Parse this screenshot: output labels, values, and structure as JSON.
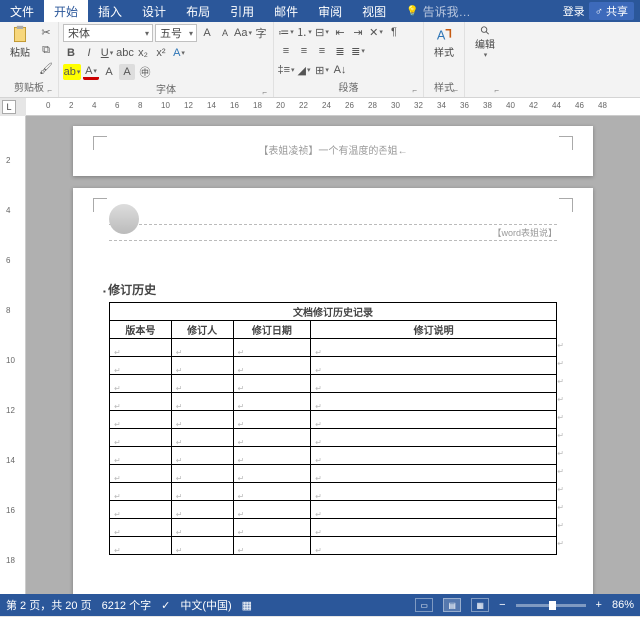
{
  "tabs": {
    "file": "文件",
    "home": "开始",
    "insert": "插入",
    "design": "设计",
    "layout": "布局",
    "references": "引用",
    "mailings": "邮件",
    "review": "审阅",
    "view": "视图",
    "tell": "告诉我…",
    "login": "登录",
    "share": "共享"
  },
  "ribbon": {
    "clipboard": {
      "label": "剪贴板",
      "paste": "粘贴"
    },
    "font": {
      "label": "字体",
      "name": "宋体",
      "size": "五号"
    },
    "paragraph": {
      "label": "段落"
    },
    "styles": {
      "label": "样式",
      "btn": "样式"
    },
    "editing": {
      "label": "",
      "btn": "编辑"
    }
  },
  "ruler": {
    "marks": [
      0,
      2,
      4,
      6,
      8,
      10,
      12,
      14,
      16,
      18,
      20,
      22,
      24,
      26,
      28,
      30,
      32,
      34,
      36,
      38,
      40,
      42,
      44,
      46,
      48
    ]
  },
  "rulerv": {
    "marks": [
      2,
      4,
      6,
      8,
      10,
      12,
      14,
      16,
      18
    ]
  },
  "page1": {
    "header": "【表姐凌祯】一个有温度的존姐←"
  },
  "page2": {
    "breaklabel": "【word表姐说】",
    "section": "修订历史",
    "table": {
      "title": "文档修订历史记录",
      "headers": [
        "版本号",
        "修订人",
        "修订日期",
        "修订说明"
      ],
      "rows": 12
    }
  },
  "status": {
    "page": "第 2 页，共 20 页",
    "words": "6212 个字",
    "lang": "中文(中国)",
    "zoom": "86%"
  }
}
